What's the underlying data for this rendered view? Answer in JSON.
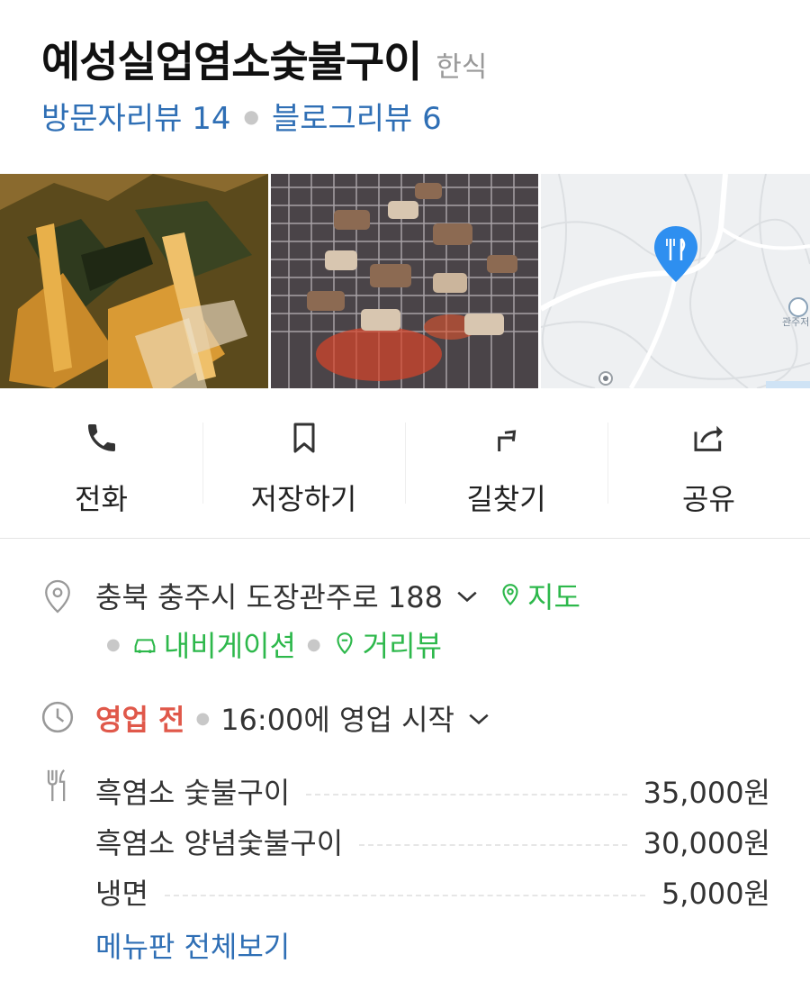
{
  "place": {
    "title": "예성실업염소숯불구이",
    "category": "한식",
    "visitor_reviews": "방문자리뷰 14",
    "blog_reviews": "블로그리뷰 6"
  },
  "photos": [
    {
      "name": "pickled-vegetables-photo"
    },
    {
      "name": "grilled-meat-photo"
    },
    {
      "name": "map-thumbnail",
      "map_label": "관주저"
    }
  ],
  "actions": [
    {
      "label": "전화",
      "icon": "phone-icon"
    },
    {
      "label": "저장하기",
      "icon": "bookmark-icon"
    },
    {
      "label": "길찾기",
      "icon": "directions-icon"
    },
    {
      "label": "공유",
      "icon": "share-icon"
    }
  ],
  "address": {
    "text": "충북 충주시 도장관주로 188",
    "map_link": "지도",
    "navigation_link": "내비게이션",
    "street_view_link": "거리뷰"
  },
  "hours": {
    "status": "영업 전",
    "detail": "16:00에 영업 시작"
  },
  "menu": {
    "items": [
      {
        "name": "흑염소 숯불구이",
        "price": "35,000원"
      },
      {
        "name": "흑염소 양념숯불구이",
        "price": "30,000원"
      },
      {
        "name": "냉면",
        "price": "5,000원"
      }
    ],
    "more_label": "메뉴판 전체보기"
  },
  "colors": {
    "link_blue": "#2f6fb5",
    "link_green": "#2db84b",
    "status_red": "#e0584a",
    "map_pin": "#2e8ff0"
  }
}
